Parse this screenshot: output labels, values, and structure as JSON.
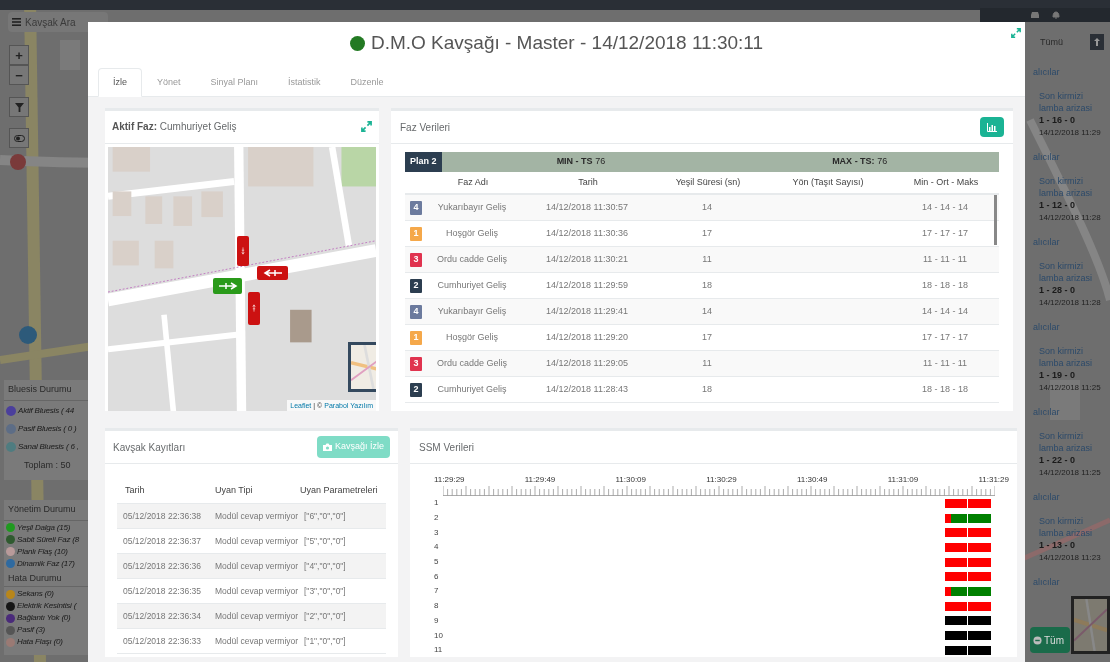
{
  "background": {
    "search": {
      "placeholder": "Kavşak Ara"
    },
    "zoom": {
      "in": "+",
      "out": "−"
    },
    "bluesis": {
      "title": "Bluesis Durumu",
      "items": [
        {
          "label": "Aktif Bluesis ( 44",
          "color": "#4b3f9c"
        },
        {
          "label": "Pasif Bluesis ( 0 )",
          "color": "#5d6d86"
        },
        {
          "label": "Sanal Bluesis ( 6 ,",
          "color": "#4f7c80"
        }
      ],
      "total": "Toplam : 50"
    },
    "management": {
      "title": "Yönetim Durumu",
      "items": [
        {
          "label": "Yeşil Dalga (15)",
          "color": "#1f9a1f"
        },
        {
          "label": "Sabit Süreli Faz (8",
          "color": "#2f5a2f"
        },
        {
          "label": "Planlı Flaş (10)",
          "color": "#b89a9a"
        },
        {
          "label": "Dinamik Faz (17)",
          "color": "#2f6aa0"
        }
      ]
    },
    "errors": {
      "title": "Hata Durumu",
      "items": [
        {
          "label": "Sekans (0)",
          "color": "#b8861a"
        },
        {
          "label": "Elektrik Kesintisi (",
          "color": "#151515"
        },
        {
          "label": "Bağlantı Yok (0)",
          "color": "#4a2a7a"
        },
        {
          "label": "Pasif (3)",
          "color": "#555555"
        },
        {
          "label": "Hata Flaşı (0)",
          "color": "#9a7a74"
        }
      ]
    },
    "filter": "Tümü",
    "notifications": [
      {
        "heading": "alıcılar",
        "message": "Son kirmizi lamba arizasi",
        "code": "1 - 16 - 0",
        "time": "14/12/2018 11:29"
      },
      {
        "heading": "alıcılar",
        "message": "Son kirmizi lamba arizasi",
        "code": "1 - 12 - 0",
        "time": "14/12/2018 11:28"
      },
      {
        "heading": "alıcılar",
        "message": "Son kirmizi lamba arizasi",
        "code": "1 - 28 - 0",
        "time": "14/12/2018 11:28"
      },
      {
        "heading": "alıcılar",
        "message": "Son kirmizi lamba arizasi",
        "code": "1 - 19 - 0",
        "time": "14/12/2018 11:25"
      },
      {
        "heading": "alıcılar",
        "message": "Son kirmizi lamba arizasi",
        "code": "1 - 22 - 0",
        "time": "14/12/2018 11:25"
      },
      {
        "heading": "alıcılar",
        "message": "Son kirmizi lamba arizasi",
        "code": "1 - 13 - 0",
        "time": "14/12/2018 11:23"
      }
    ],
    "last_heading": "alıcılar",
    "all_button": "Tüm"
  },
  "modal": {
    "title": "D.M.O Kavşağı - Master - 14/12/2018 11:30:11",
    "status_dot": {
      "color": "#237a23"
    },
    "tabs": [
      {
        "label": "İzle",
        "selected": true
      },
      {
        "label": "Yönet",
        "selected": false
      },
      {
        "label": "Sinyal Planı",
        "selected": false
      },
      {
        "label": "İstatistik",
        "selected": false
      },
      {
        "label": "Düzenle",
        "selected": false
      }
    ]
  },
  "active_phase": {
    "label": "Aktif Faz:",
    "value": "Cumhuriyet Geliş",
    "signals": [
      {
        "kind": "down",
        "color": "#cc1111"
      },
      {
        "kind": "left",
        "color": "#cc1111"
      },
      {
        "kind": "right",
        "color": "#2a9a1a"
      },
      {
        "kind": "up",
        "color": "#cc1111"
      }
    ],
    "attribution": {
      "link": "Leaflet",
      "separator": "| ©",
      "owner": "Parabol Yazılım"
    }
  },
  "phase_data": {
    "title": "Faz Verileri",
    "plan": "Plan 2",
    "min": "**MIN - TS** 76",
    "max": "**MAX - TS:** 76",
    "columns": [
      "Faz Adı",
      "Tarih",
      "Yeşil Süresi (sn)",
      "Yön (Taşıt Sayısı)",
      "Min - Ort - Maks"
    ],
    "rows": [
      {
        "badge": "4",
        "color": "#6c7b9e",
        "name": "Yukarıbayır Geliş",
        "date": "14/12/2018 11:30:57",
        "green": "14",
        "range": "14 - 14 - 14"
      },
      {
        "badge": "1",
        "color": "#f5a84a",
        "name": "Hoşgör Geliş",
        "date": "14/12/2018 11:30:36",
        "green": "17",
        "range": "17 - 17 - 17"
      },
      {
        "badge": "3",
        "color": "#e0334f",
        "name": "Ordu cadde Geliş",
        "date": "14/12/2018 11:30:21",
        "green": "11",
        "range": "11 - 11 - 11"
      },
      {
        "badge": "2",
        "color": "#2c3e50",
        "name": "Cumhuriyet Geliş",
        "date": "14/12/2018 11:29:59",
        "green": "18",
        "range": "18 - 18 - 18"
      },
      {
        "badge": "4",
        "color": "#6c7b9e",
        "name": "Yukarıbayır Geliş",
        "date": "14/12/2018 11:29:41",
        "green": "14",
        "range": "14 - 14 - 14"
      },
      {
        "badge": "1",
        "color": "#f5a84a",
        "name": "Hoşgör Geliş",
        "date": "14/12/2018 11:29:20",
        "green": "17",
        "range": "17 - 17 - 17"
      },
      {
        "badge": "3",
        "color": "#e0334f",
        "name": "Ordu cadde Geliş",
        "date": "14/12/2018 11:29:05",
        "green": "11",
        "range": "11 - 11 - 11"
      },
      {
        "badge": "2",
        "color": "#2c3e50",
        "name": "Cumhuriyet Geliş",
        "date": "14/12/2018 11:28:43",
        "green": "18",
        "range": "18 - 18 - 18"
      }
    ]
  },
  "records": {
    "title": "Kavşak Kayıtları",
    "button": "Kavşağı İzle",
    "columns": [
      "Tarih",
      "Uyan Tipi",
      "Uyan Parametreleri"
    ],
    "rows": [
      {
        "date": "05/12/2018 22:36:38",
        "type": "Modül cevap vermiyor",
        "params": "[\"6\",\"0\",\"0\"]"
      },
      {
        "date": "05/12/2018 22:36:37",
        "type": "Modül cevap vermiyor",
        "params": "[\"5\",\"0\",\"0\"]"
      },
      {
        "date": "05/12/2018 22:36:36",
        "type": "Modül cevap vermiyor",
        "params": "[\"4\",\"0\",\"0\"]"
      },
      {
        "date": "05/12/2018 22:36:35",
        "type": "Modül cevap vermiyor",
        "params": "[\"3\",\"0\",\"0\"]"
      },
      {
        "date": "05/12/2018 22:36:34",
        "type": "Modül cevap vermiyor",
        "params": "[\"2\",\"0\",\"0\"]"
      },
      {
        "date": "05/12/2018 22:36:33",
        "type": "Modül cevap vermiyor",
        "params": "[\"1\",\"0\",\"0\"]"
      }
    ]
  },
  "ssm": {
    "title": "SSM Verileri",
    "ticks": [
      "11:29:29",
      "11:29:49",
      "11:30:09",
      "11:30:29",
      "11:30:49",
      "11:31:09",
      "11:31:29"
    ],
    "rows": [
      {
        "label": "1",
        "kind": "stop"
      },
      {
        "label": "2",
        "kind": "go"
      },
      {
        "label": "3",
        "kind": "stop"
      },
      {
        "label": "4",
        "kind": "stop"
      },
      {
        "label": "5",
        "kind": "stop"
      },
      {
        "label": "6",
        "kind": "stop"
      },
      {
        "label": "7",
        "kind": "go"
      },
      {
        "label": "8",
        "kind": "stop"
      },
      {
        "label": "9",
        "kind": "dark"
      },
      {
        "label": "10",
        "kind": "dark"
      },
      {
        "label": "11",
        "kind": "dark"
      }
    ]
  }
}
